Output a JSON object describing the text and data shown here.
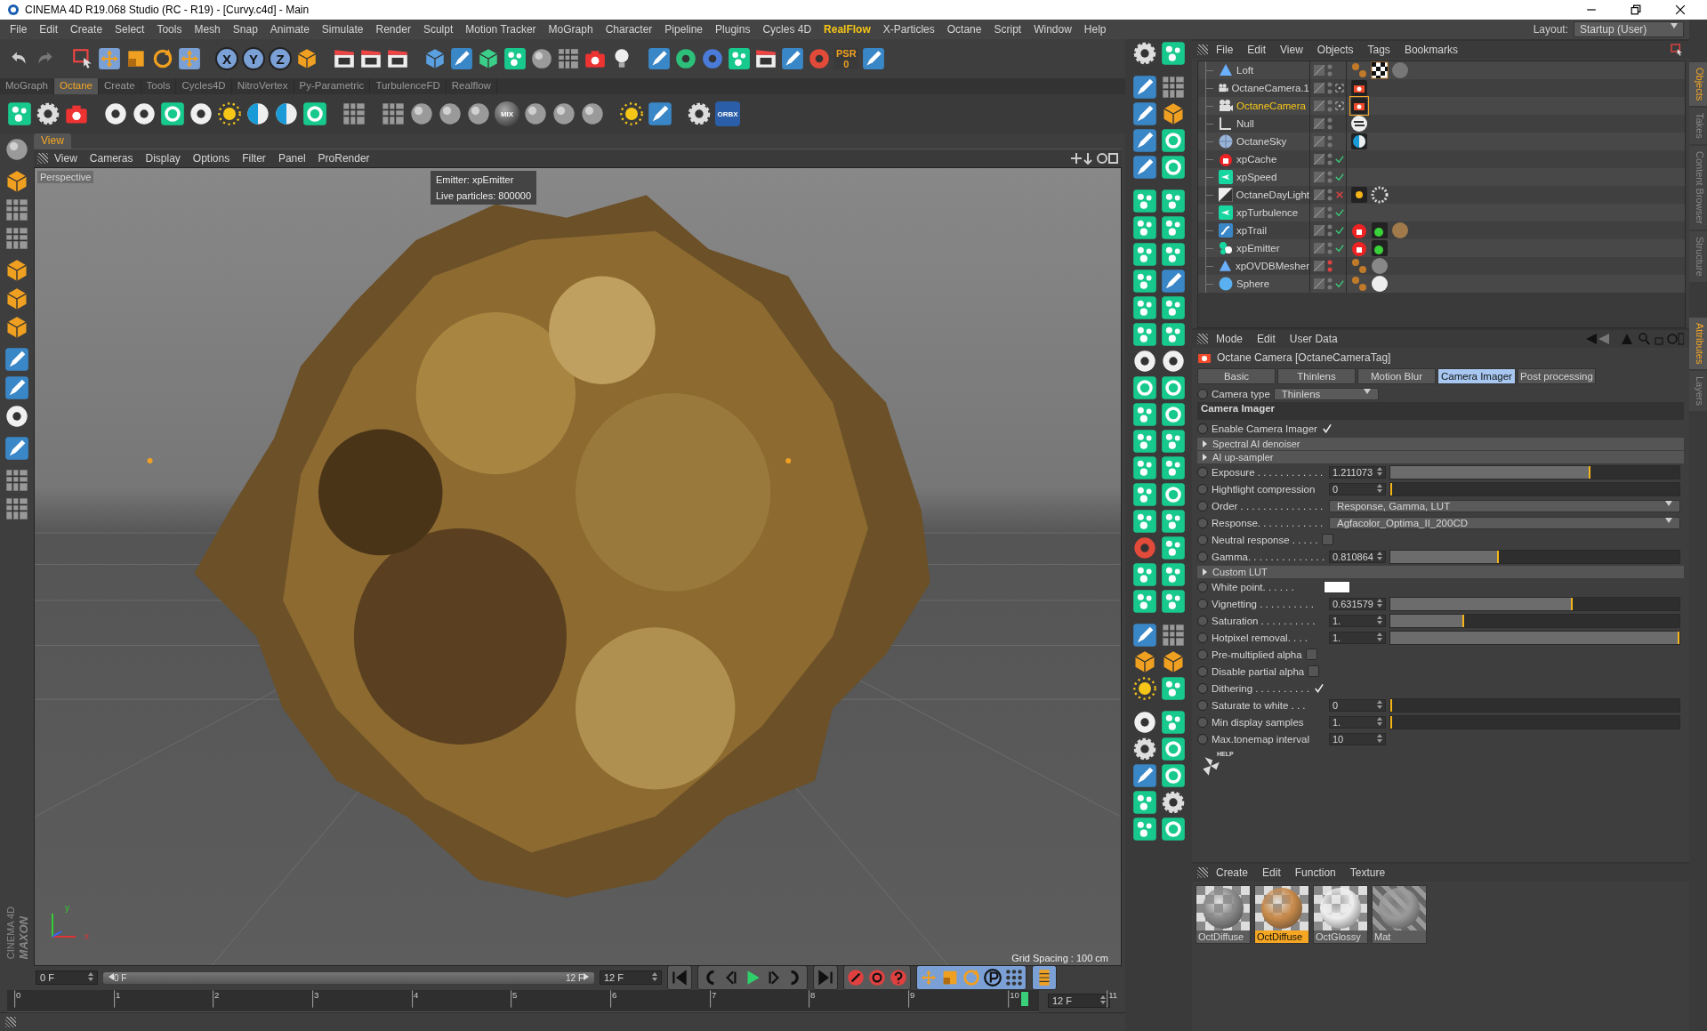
{
  "window": {
    "title": "CINEMA 4D R19.068 Studio (RC - R19) - [Curvy.c4d] - Main"
  },
  "menu": [
    {
      "label": "File",
      "highlighted": false
    },
    {
      "label": "Edit",
      "highlighted": false
    },
    {
      "label": "Create",
      "highlighted": false
    },
    {
      "label": "Select",
      "highlighted": false
    },
    {
      "label": "Tools",
      "highlighted": false
    },
    {
      "label": "Mesh",
      "highlighted": false
    },
    {
      "label": "Snap",
      "highlighted": false
    },
    {
      "label": "Animate",
      "highlighted": false
    },
    {
      "label": "Simulate",
      "highlighted": false
    },
    {
      "label": "Render",
      "highlighted": false
    },
    {
      "label": "Sculpt",
      "highlighted": false
    },
    {
      "label": "Motion Tracker",
      "highlighted": false
    },
    {
      "label": "MoGraph",
      "highlighted": false
    },
    {
      "label": "Character",
      "highlighted": false
    },
    {
      "label": "Pipeline",
      "highlighted": false
    },
    {
      "label": "Plugins",
      "highlighted": false
    },
    {
      "label": "Cycles 4D",
      "highlighted": false
    },
    {
      "label": "RealFlow",
      "highlighted": true
    },
    {
      "label": "X-Particles",
      "highlighted": false
    },
    {
      "label": "Octane",
      "highlighted": false
    },
    {
      "label": "Script",
      "highlighted": false
    },
    {
      "label": "Window",
      "highlighted": false
    },
    {
      "label": "Help",
      "highlighted": false
    }
  ],
  "layout": {
    "label": "Layout:",
    "value": "Startup (User)"
  },
  "axis_buttons": [
    "X",
    "Y",
    "Z"
  ],
  "psr": {
    "label": "PSR",
    "value": "0"
  },
  "palette_tabs": [
    {
      "label": "MoGraph",
      "selected": false
    },
    {
      "label": "Octane",
      "selected": true
    },
    {
      "label": "Create",
      "selected": false
    },
    {
      "label": "Tools",
      "selected": false
    },
    {
      "label": "Cycles4D",
      "selected": false
    },
    {
      "label": "NitroVertex",
      "selected": false
    },
    {
      "label": "Py-Parametric",
      "selected": false
    },
    {
      "label": "TurbulenceFD",
      "selected": false
    },
    {
      "label": "Realflow",
      "selected": false
    }
  ],
  "octane_toolbar": {
    "mix": "MIX",
    "orbx": "ORBX"
  },
  "viewport": {
    "tab": "View",
    "menu": [
      "View",
      "Cameras",
      "Display",
      "Options",
      "Filter",
      "Panel",
      "ProRender"
    ],
    "camera": "Perspective",
    "hud": [
      "Emitter: xpEmitter",
      "Live particles: 800000"
    ],
    "grid_spacing": "Grid Spacing : 100 cm",
    "axes": [
      "y",
      "x"
    ]
  },
  "logo": [
    "MAXON",
    "CINEMA 4D"
  ],
  "objects": {
    "menu": [
      "File",
      "Edit",
      "View",
      "Objects",
      "Tags",
      "Bookmarks"
    ],
    "items": [
      {
        "name": "Loft",
        "icon": {
          "kind": "loft"
        },
        "selected": false,
        "hidden": false,
        "tags": [
          {
            "kind": "dots"
          },
          {
            "kind": "checker"
          },
          {
            "kind": "sphere-grey"
          }
        ]
      },
      {
        "name": "OctaneCamera.1",
        "icon": {
          "kind": "camera"
        },
        "selected": false,
        "hidden": false,
        "marker": {
          "kind": "target"
        },
        "tags": [
          {
            "kind": "camera"
          }
        ]
      },
      {
        "name": "OctaneCamera",
        "icon": {
          "kind": "camera"
        },
        "selected": true,
        "hidden": false,
        "marker": {
          "kind": "target"
        },
        "tags": [
          {
            "kind": "camera-selected"
          }
        ]
      },
      {
        "name": "Null",
        "icon": {
          "kind": "null"
        },
        "selected": false,
        "hidden": false,
        "tags": [
          {
            "kind": "arrows"
          }
        ]
      },
      {
        "name": "OctaneSky",
        "icon": {
          "kind": "sky"
        },
        "selected": false,
        "hidden": false,
        "tags": [
          {
            "kind": "sky"
          }
        ]
      },
      {
        "name": "xpCache",
        "icon": {
          "kind": "xp-red"
        },
        "selected": false,
        "hidden": false,
        "marker": {
          "kind": "check"
        }
      },
      {
        "name": "xpSpeed",
        "icon": {
          "kind": "xp-teal"
        },
        "selected": false,
        "hidden": false,
        "marker": {
          "kind": "check"
        }
      },
      {
        "name": "OctaneDayLight",
        "icon": {
          "kind": "daylight"
        },
        "selected": false,
        "hidden": false,
        "marker": {
          "kind": "cross"
        },
        "tags": [
          {
            "kind": "sun"
          },
          {
            "kind": "gear"
          }
        ]
      },
      {
        "name": "xpTurbulence",
        "icon": {
          "kind": "xp-teal"
        },
        "selected": false,
        "hidden": false,
        "marker": {
          "kind": "check"
        }
      },
      {
        "name": "xpTrail",
        "icon": {
          "kind": "xp-blue"
        },
        "selected": false,
        "hidden": false,
        "marker": {
          "kind": "check"
        },
        "tags": [
          {
            "kind": "xp-red"
          },
          {
            "kind": "green"
          },
          {
            "kind": "sphere-brown"
          }
        ]
      },
      {
        "name": "xpEmitter",
        "icon": {
          "kind": "xp-emitter"
        },
        "selected": false,
        "hidden": false,
        "marker": {
          "kind": "check"
        },
        "tags": [
          {
            "kind": "xp-red"
          },
          {
            "kind": "green"
          }
        ]
      },
      {
        "name": "xpOVDBMesher",
        "icon": {
          "kind": "loft"
        },
        "selected": false,
        "hidden": true,
        "tags": [
          {
            "kind": "dots"
          },
          {
            "kind": "sphere-texture"
          }
        ]
      },
      {
        "name": "Sphere",
        "icon": {
          "kind": "sphere"
        },
        "selected": false,
        "hidden": false,
        "marker": {
          "kind": "check"
        },
        "tags": [
          {
            "kind": "dots"
          },
          {
            "kind": "sphere-white"
          }
        ]
      }
    ]
  },
  "side_tabs_top": [
    {
      "label": "Objects",
      "selected": true
    },
    {
      "label": "Takes",
      "selected": false
    },
    {
      "label": "Content Browser",
      "selected": false
    },
    {
      "label": "Structure",
      "selected": false
    }
  ],
  "side_tabs_bottom": [
    {
      "label": "Attributes",
      "selected": true
    },
    {
      "label": "Layers",
      "selected": false
    }
  ],
  "attributes": {
    "menu": [
      "Mode",
      "Edit",
      "User Data"
    ],
    "title": "Octane Camera [OctaneCameraTag]",
    "tabs": [
      {
        "label": "Basic",
        "selected": false
      },
      {
        "label": "Thinlens",
        "selected": false
      },
      {
        "label": "Motion Blur",
        "selected": false
      },
      {
        "label": "Camera Imager",
        "selected": true
      },
      {
        "label": "Post processing",
        "selected": false
      }
    ],
    "camera_type": {
      "label": "Camera type",
      "value": "Thinlens",
      "keyed": false
    },
    "section": "Camera Imager",
    "rows": [
      {
        "kind": "checkbox",
        "label": "Enable Camera Imager",
        "checked": true,
        "keyed": false
      },
      {
        "kind": "group",
        "label": "Spectral AI denoiser"
      },
      {
        "kind": "group",
        "label": "AI up-sampler"
      },
      {
        "kind": "slider",
        "label": "Exposure . . . . . . . . . . . .",
        "value": "1.211073",
        "level": 0.69,
        "keyed": false
      },
      {
        "kind": "slider",
        "label": "Hightlight compression",
        "value": "0",
        "level": 0,
        "keyed": false
      },
      {
        "kind": "dropdown",
        "label": "Order . . . . . . . . . . . . . . .",
        "value": "Response, Gamma, LUT",
        "keyed": false
      },
      {
        "kind": "dropdown",
        "label": "Response. . . . . . . . . . . .",
        "value": "Agfacolor_Optima_II_200CD",
        "keyed": false
      },
      {
        "kind": "checkbox",
        "label": "Neutral response . . . . .",
        "checked": false,
        "keyed": false
      },
      {
        "kind": "slider",
        "label": "Gamma. . . . . . . . . . . . . .",
        "value": "0.810864",
        "level": 0.37,
        "keyed": false
      },
      {
        "kind": "group",
        "label": "Custom LUT"
      },
      {
        "kind": "color",
        "label": "White point. . . . . .",
        "color": "#ffffff",
        "keyed": false
      },
      {
        "kind": "slider",
        "label": "Vignetting . . . . . . . . . .",
        "value": "0.631579",
        "level": 0.63,
        "keyed": false
      },
      {
        "kind": "slider",
        "label": "Saturation . . . . . . . . . .",
        "value": "1.",
        "level": 0.25,
        "keyed": false
      },
      {
        "kind": "slider",
        "label": "Hotpixel removal. . . .",
        "value": "1.",
        "level": 1,
        "keyed": false
      },
      {
        "kind": "checkbox",
        "label": "Pre-multiplied alpha",
        "checked": false,
        "keyed": false
      },
      {
        "kind": "checkbox",
        "label": "Disable partial alpha",
        "checked": false,
        "keyed": false
      },
      {
        "kind": "checkbox",
        "label": "Dithering . . . . . . . . . .",
        "checked": true,
        "keyed": false
      },
      {
        "kind": "slider",
        "label": "Saturate to white . . .",
        "value": "0",
        "level": 0,
        "keyed": false
      },
      {
        "kind": "slider",
        "label": "Min display samples",
        "value": "1.",
        "level": 0,
        "keyed": false
      },
      {
        "kind": "field",
        "label": "Max.tonemap interval",
        "value": "10",
        "keyed": false
      }
    ],
    "help": "HELP"
  },
  "materials": {
    "menu": [
      "Create",
      "Edit",
      "Function",
      "Texture"
    ],
    "items": [
      {
        "name": "OctDiffuse",
        "kind": "grey",
        "selected": false
      },
      {
        "name": "OctDiffuse",
        "kind": "orange",
        "selected": true
      },
      {
        "name": "OctGlossy",
        "kind": "white",
        "selected": false
      },
      {
        "name": "Mat",
        "kind": "texture",
        "selected": false
      }
    ]
  },
  "timeline": {
    "start": "0 F",
    "range_start": "0 F",
    "range_end": "12 F",
    "end": "12 F",
    "ruler": [
      "0",
      "1",
      "2",
      "3",
      "4",
      "5",
      "6",
      "7",
      "8",
      "9",
      "10",
      "11"
    ],
    "current": "12 F",
    "level": 0.99
  }
}
